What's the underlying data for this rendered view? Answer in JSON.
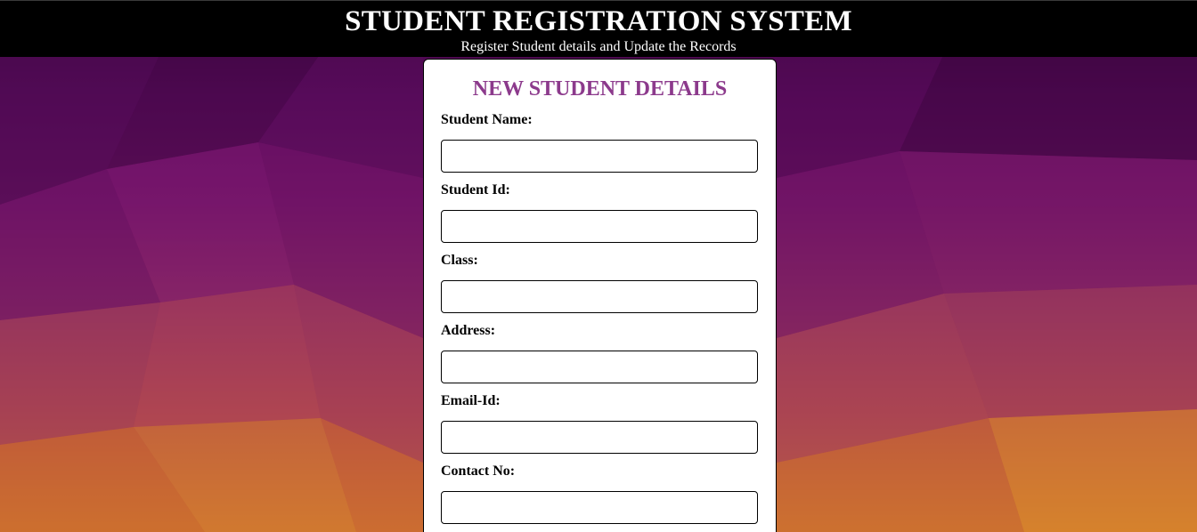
{
  "header": {
    "title": "STUDENT REGISTRATION SYSTEM",
    "subtitle": "Register Student details and Update the Records"
  },
  "form": {
    "title": "NEW STUDENT DETAILS",
    "fields": [
      {
        "label": "Student Name:",
        "value": ""
      },
      {
        "label": "Student Id:",
        "value": ""
      },
      {
        "label": "Class:",
        "value": ""
      },
      {
        "label": "Address:",
        "value": ""
      },
      {
        "label": "Email-Id:",
        "value": ""
      },
      {
        "label": "Contact No:",
        "value": ""
      }
    ]
  },
  "colors": {
    "header_bg": "#000000",
    "form_title": "#8c3a8c",
    "background_top": "#3d0640",
    "background_bottom": "#d27830"
  }
}
